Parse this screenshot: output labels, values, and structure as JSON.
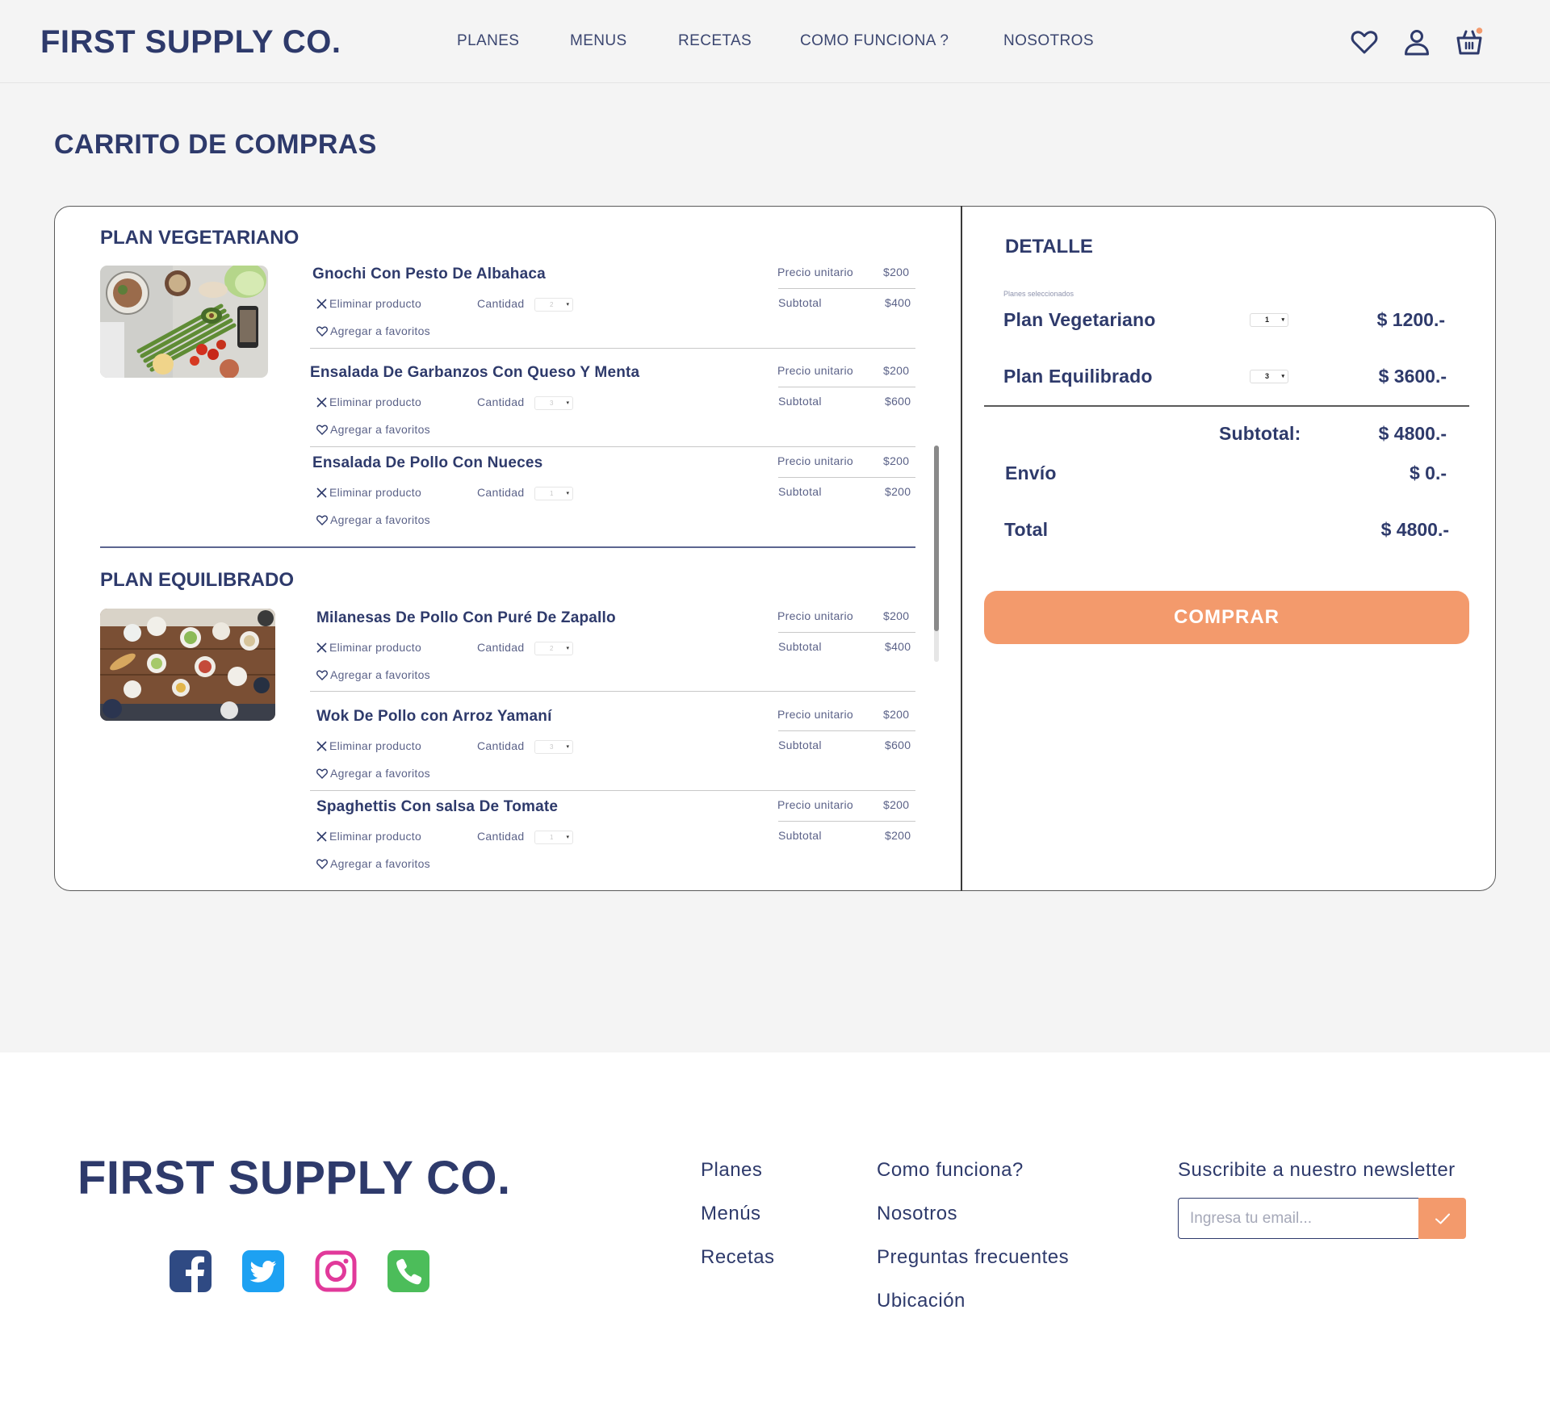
{
  "header": {
    "logo": "FIRST SUPPLY CO.",
    "nav": [
      "PLANES",
      "MENUS",
      "RECETAS",
      "COMO FUNCIONA ?",
      "NOSOTROS"
    ],
    "icons": [
      "heart-icon",
      "user-icon",
      "basket-icon"
    ],
    "cart_badge_color": "#f39a6c"
  },
  "page": {
    "title": "CARRITO DE COMPRAS"
  },
  "labels": {
    "precio_unitario": "Precio unitario",
    "subtotal": "Subtotal",
    "eliminar": "Eliminar producto",
    "cantidad": "Cantidad",
    "favoritos": "Agregar a favoritos"
  },
  "plans": [
    {
      "title": "PLAN VEGETARIANO",
      "items": [
        {
          "name": "Gnochi Con Pesto De Albahaca",
          "qty": "2",
          "unit_price": "$200",
          "subtotal": "$400"
        },
        {
          "name": "Ensalada De Garbanzos Con Queso Y Menta",
          "qty": "3",
          "unit_price": "$200",
          "subtotal": "$600"
        },
        {
          "name": "Ensalada De Pollo Con Nueces",
          "qty": "1",
          "unit_price": "$200",
          "subtotal": "$200"
        }
      ]
    },
    {
      "title": "PLAN EQUILIBRADO",
      "items": [
        {
          "name": "Milanesas De Pollo Con Puré De Zapallo",
          "qty": "2",
          "unit_price": "$200",
          "subtotal": "$400"
        },
        {
          "name": "Wok De Pollo con Arroz Yamaní",
          "qty": "3",
          "unit_price": "$200",
          "subtotal": "$600"
        },
        {
          "name": "Spaghettis Con salsa De Tomate",
          "qty": "1",
          "unit_price": "$200",
          "subtotal": "$200"
        }
      ]
    }
  ],
  "detail": {
    "title": "DETALLE",
    "selected_label": "Planes seleccionados",
    "plans": [
      {
        "name": "Plan Vegetariano",
        "qty": "1",
        "price": "$ 1200.-"
      },
      {
        "name": "Plan Equilibrado",
        "qty": "3",
        "price": "$ 3600.-"
      }
    ],
    "subtotal_label": "Subtotal:",
    "subtotal": "$ 4800.-",
    "envio_label": "Envío",
    "envio": "$ 0.-",
    "total_label": "Total",
    "total": "$ 4800.-",
    "buy_button": "COMPRAR",
    "buy_color": "#f39a6c"
  },
  "footer": {
    "logo": "FIRST SUPPLY CO.",
    "col1": [
      "Planes",
      "Menús",
      "Recetas"
    ],
    "col2": [
      "Como funciona?",
      "Nosotros",
      "Preguntas frecuentes",
      "Ubicación"
    ],
    "newsletter_title": "Suscribite a nuestro newsletter",
    "newsletter_placeholder": "Ingresa tu email...",
    "social": [
      {
        "icon": "facebook-icon",
        "color": "#2f4a83"
      },
      {
        "icon": "twitter-icon",
        "color": "#1da1f2"
      },
      {
        "icon": "instagram-icon",
        "color": "#e1399a"
      },
      {
        "icon": "phone-icon",
        "color": "#4cbd5a"
      }
    ]
  }
}
